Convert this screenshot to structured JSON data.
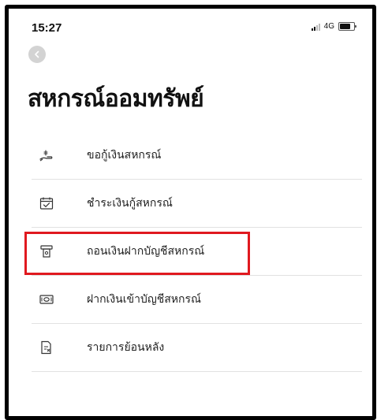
{
  "status_bar": {
    "time": "15:27",
    "network": "4G"
  },
  "page": {
    "title": "สหกรณ์ออมทรัพย์"
  },
  "menu": {
    "items": [
      {
        "label": "ขอกู้เงินสหกรณ์",
        "icon": "hand-money-icon"
      },
      {
        "label": "ชำระเงินกู้สหกรณ์",
        "icon": "calendar-check-icon"
      },
      {
        "label": "ถอนเงินฝากบัญชีสหกรณ์",
        "icon": "atm-withdraw-icon"
      },
      {
        "label": "ฝากเงินเข้าบัญชีสหกรณ์",
        "icon": "cash-deposit-icon"
      },
      {
        "label": "รายการย้อนหลัง",
        "icon": "history-document-icon"
      }
    ]
  },
  "colors": {
    "highlight": "#e0191f",
    "divider": "#e2e2e2",
    "text": "#222222"
  }
}
